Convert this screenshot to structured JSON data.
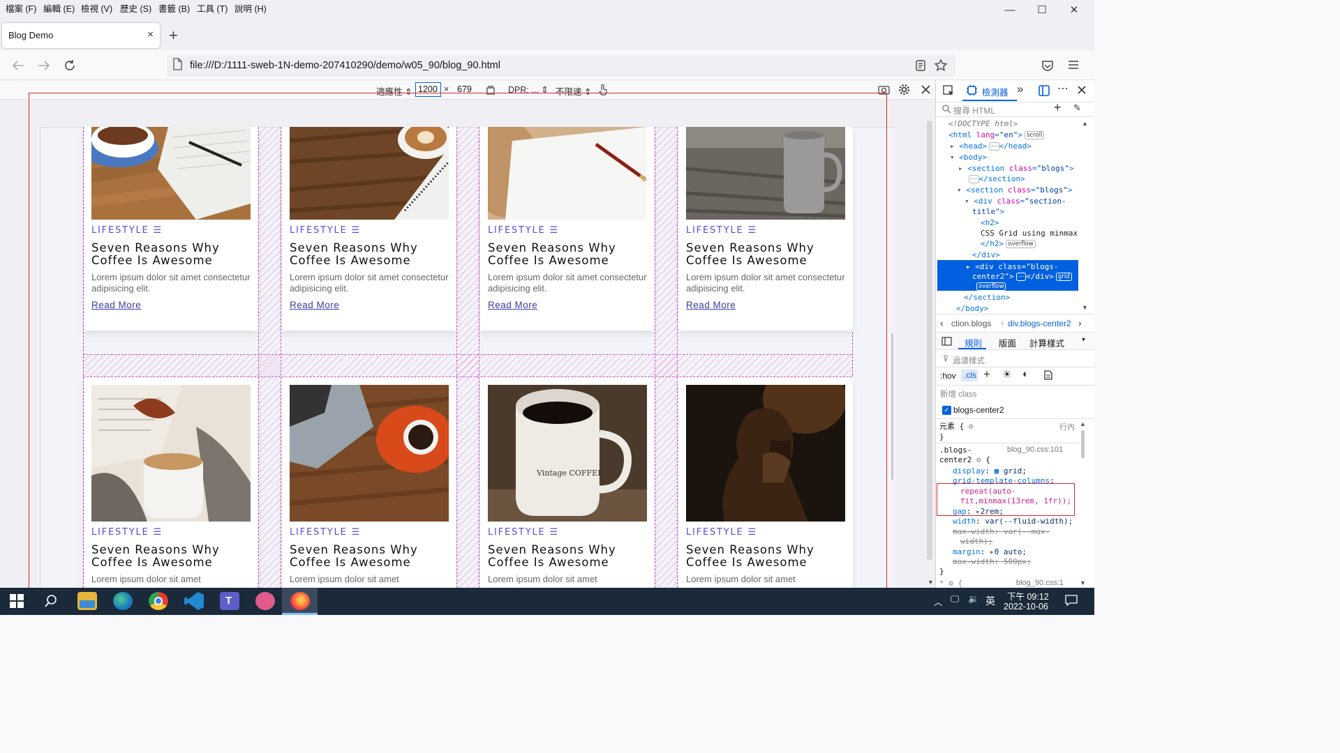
{
  "menubar": {
    "items": [
      "檔案 (F)",
      "編輯 (E)",
      "檢視 (V)",
      "歷史 (S)",
      "書籤 (B)",
      "工具 (T)",
      "說明 (H)"
    ]
  },
  "window_controls": {
    "minimize": "—",
    "maximize": "☐",
    "close": "✕"
  },
  "tab": {
    "title": "Blog Demo",
    "close": "×",
    "new_tab": "+"
  },
  "navbar": {
    "url": "file:///D:/1111-sweb-1N-demo-207410290/demo/w05_90/blog_90.html"
  },
  "rdm": {
    "preset": "適應性 ⇕",
    "width": "1200",
    "times": "×",
    "height": "679",
    "dpr": "DPR: ... ⇕",
    "throttle": "不限速 ⇕"
  },
  "cards": [
    {
      "category": "LIFESTYLE",
      "title": "Seven Reasons Why Coffee Is Awesome",
      "desc": "Lorem ipsum dolor sit amet consectetur adipisicing elit.",
      "link": "Read More"
    },
    {
      "category": "LIFESTYLE",
      "title": "Seven Reasons Why Coffee Is Awesome",
      "desc": "Lorem ipsum dolor sit amet consectetur adipisicing elit.",
      "link": "Read More"
    },
    {
      "category": "LIFESTYLE",
      "title": "Seven Reasons Why Coffee Is Awesome",
      "desc": "Lorem ipsum dolor sit amet consectetur adipisicing elit.",
      "link": "Read More"
    },
    {
      "category": "LIFESTYLE",
      "title": "Seven Reasons Why Coffee Is Awesome",
      "desc": "Lorem ipsum dolor sit amet consectetur adipisicing elit.",
      "link": "Read More"
    },
    {
      "category": "LIFESTYLE",
      "title": "Seven Reasons Why Coffee Is Awesome",
      "desc": "Lorem ipsum dolor sit amet",
      "link": ""
    },
    {
      "category": "LIFESTYLE",
      "title": "Seven Reasons Why Coffee Is Awesome",
      "desc": "Lorem ipsum dolor sit amet",
      "link": ""
    },
    {
      "category": "LIFESTYLE",
      "title": "Seven Reasons Why Coffee Is Awesome",
      "desc": "Lorem ipsum dolor sit amet",
      "link": ""
    },
    {
      "category": "LIFESTYLE",
      "title": "Seven Reasons Why Coffee Is Awesome",
      "desc": "Lorem ipsum dolor sit amet",
      "link": ""
    }
  ],
  "devtools": {
    "inspector_tab": "檢測器",
    "search_placeholder": "搜尋 HTML",
    "breadcrumb_1": "ction.blogs",
    "breadcrumb_2": "div.blogs-center2",
    "panel_tabs": [
      "規則",
      "版面",
      "計算樣式"
    ],
    "filter_placeholder": "過濾樣式",
    "hov": ":hov",
    "cls": ".cls",
    "new_class": "新增 class",
    "class_name": "blogs-center2",
    "element_label": "元素",
    "inline_label": "行內",
    "rule_source": "blog_90.css:101",
    "rule_source_2": "blog_90.css:1",
    "selector_1": ".blogs-",
    "selector_2": "center2",
    "html": {
      "doctype": "<!DOCTYPE html>",
      "h2_text": "CSS Grid using minmax",
      "badge_scroll": "scroll",
      "badge_overflow": "overflow",
      "badge_grid": "grid"
    },
    "css": {
      "display": "grid",
      "gtc_1": "repeat(auto-",
      "gtc_2": "fit,minmax(13rem, 1fr));",
      "gap": "2rem;",
      "width": "var(--fluid-width);",
      "max_width_1": "var(--max-",
      "max_width_2": "width);",
      "margin": "0 auto;",
      "max_width_3": "500px;"
    }
  },
  "taskbar": {
    "time": "下午 09:12",
    "date": "2022-10-06",
    "ime": "英"
  }
}
